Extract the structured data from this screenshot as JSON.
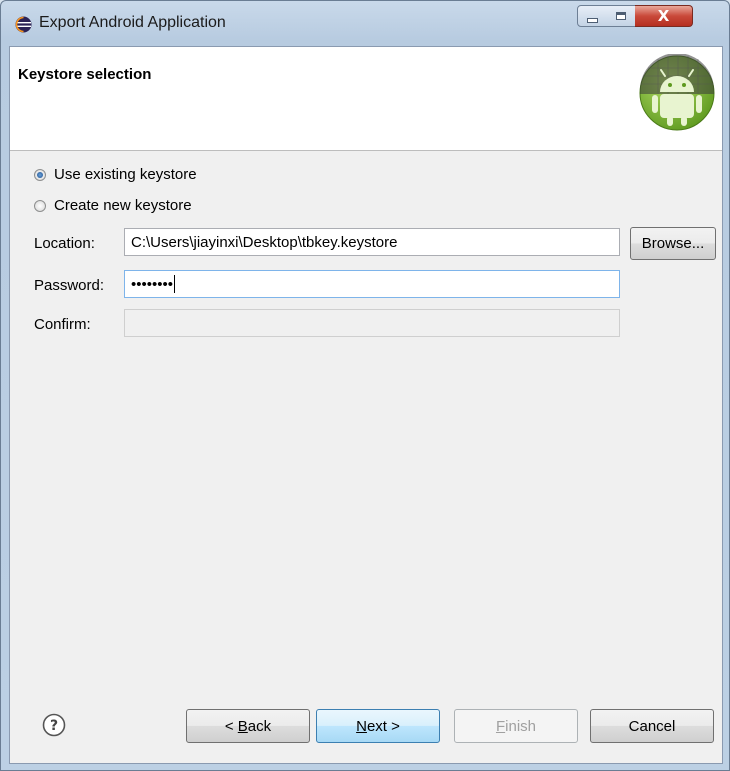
{
  "window": {
    "title": "Export Android Application"
  },
  "header": {
    "title": "Keystore selection"
  },
  "options": {
    "use_existing": "Use existing keystore",
    "create_new": "Create new keystore",
    "selected": "use_existing"
  },
  "form": {
    "location_label": "Location:",
    "location_value": "C:\\Users\\jiayinxi\\Desktop\\tbkey.keystore",
    "password_label": "Password:",
    "password_value": "••••••••",
    "confirm_label": "Confirm:",
    "confirm_value": ""
  },
  "buttons": {
    "browse": "Browse...",
    "back_prefix": "< ",
    "back_mnemonic": "B",
    "back_rest": "ack",
    "next_mnemonic": "N",
    "next_rest": "ext >",
    "finish_mnemonic": "F",
    "finish_rest": "inish",
    "cancel": "Cancel"
  },
  "icons": {
    "title": "eclipse-icon",
    "logo": "android-logo",
    "help": "help-icon"
  },
  "colors": {
    "android_green": "#8bc34a",
    "focus_border": "#7eb4ea"
  }
}
